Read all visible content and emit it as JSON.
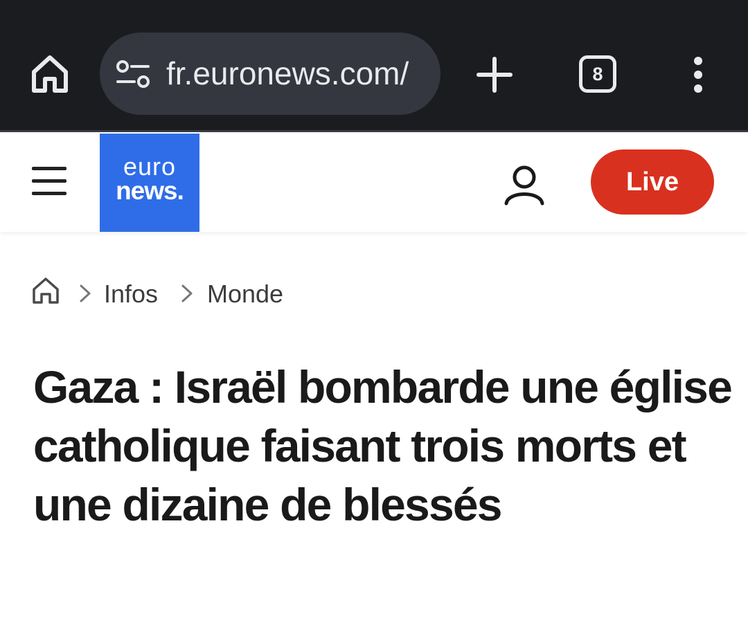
{
  "browser": {
    "home_icon": "home-icon",
    "site_info_icon": "tune-icon",
    "url": "fr.euronews.com/",
    "new_tab_icon": "plus-icon",
    "tab_count": "8",
    "menu_icon": "more-vert-icon",
    "colors": {
      "bar": "#1b1c20",
      "pill": "#34373f",
      "text": "#e9eaee"
    }
  },
  "site_header": {
    "menu_icon": "hamburger-icon",
    "logo": {
      "line1": "euro",
      "line2": "news."
    },
    "account_icon": "user-icon",
    "live_label": "Live",
    "colors": {
      "logo_bg": "#2f6de8",
      "live_bg": "#d9311f"
    }
  },
  "breadcrumb": {
    "home_icon": "home-outline-icon",
    "items": [
      "Infos",
      "Monde"
    ]
  },
  "article": {
    "headline": "Gaza : Israël bombarde une église catholique faisant trois morts et une dizaine de blessés"
  }
}
